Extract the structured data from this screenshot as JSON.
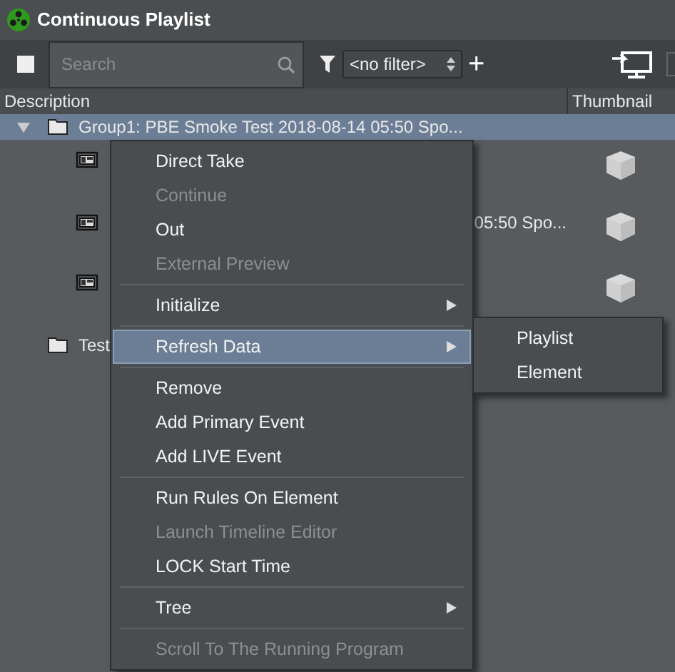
{
  "window": {
    "title": "Continuous Playlist"
  },
  "toolbar": {
    "search": {
      "placeholder": "Search"
    },
    "filter": "<no filter>",
    "add": "+"
  },
  "columns": [
    "Description",
    "Thumbnail"
  ],
  "tree": [
    {
      "kind": "group",
      "label": "Group1: PBE Smoke Test 2018-08-14 05:50 Spo...",
      "expanded": true,
      "selected": true,
      "children": [
        {
          "kind": "element",
          "selected": false
        },
        {
          "kind": "element",
          "label": "05:50 Spo...",
          "selected": false
        },
        {
          "kind": "element",
          "selected": false
        }
      ]
    },
    {
      "kind": "group",
      "label": "Test",
      "selected": false
    }
  ],
  "context_menu": {
    "items": [
      {
        "kind": "item",
        "label": "Direct Take",
        "disabled": false,
        "selected": false
      },
      {
        "kind": "item",
        "label": "Continue",
        "disabled": true,
        "selected": false
      },
      {
        "kind": "item",
        "label": "Out",
        "disabled": false,
        "selected": false
      },
      {
        "kind": "item",
        "label": "External Preview",
        "disabled": true,
        "selected": false
      },
      {
        "kind": "separator"
      },
      {
        "kind": "submenu",
        "label": "Initialize",
        "disabled": false,
        "selected": false
      },
      {
        "kind": "separator"
      },
      {
        "kind": "submenu",
        "label": "Refresh Data",
        "disabled": false,
        "selected": true
      },
      {
        "kind": "separator"
      },
      {
        "kind": "item",
        "label": "Remove",
        "disabled": false,
        "selected": false
      },
      {
        "kind": "item",
        "label": "Add Primary Event",
        "disabled": false,
        "selected": false
      },
      {
        "kind": "item",
        "label": "Add LIVE Event",
        "disabled": false,
        "selected": false
      },
      {
        "kind": "separator"
      },
      {
        "kind": "item",
        "label": "Run Rules On Element",
        "disabled": false,
        "selected": false
      },
      {
        "kind": "item",
        "label": "Launch Timeline Editor",
        "disabled": true,
        "selected": false
      },
      {
        "kind": "item",
        "label": "LOCK Start Time",
        "disabled": false,
        "selected": false
      },
      {
        "kind": "separator"
      },
      {
        "kind": "submenu",
        "label": "Tree",
        "disabled": false,
        "selected": false
      },
      {
        "kind": "separator"
      },
      {
        "kind": "item",
        "label": "Scroll To The Running Program",
        "disabled": true,
        "selected": false
      }
    ],
    "submenu": [
      {
        "label": "Playlist",
        "selected": false
      },
      {
        "label": "Element",
        "selected": false
      }
    ]
  }
}
